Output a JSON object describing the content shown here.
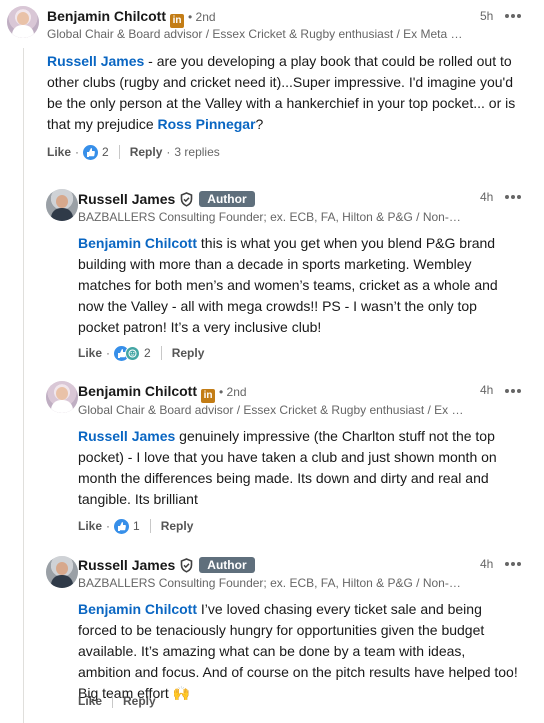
{
  "comments": [
    {
      "author": "Benjamin Chilcott",
      "linkedin_badge": "in",
      "degree": "• 2nd",
      "headline": "Global Chair & Board advisor / Essex Cricket & Rugby enthusiast / Ex Meta (u...",
      "time": "5h",
      "body": {
        "mention1": "Russell James",
        "text1": " - are you developing a play book that could be rolled out to other clubs (rugby and cricket need it)...Super impressive. I'd imagine you'd be the only person at the Valley with a hankerchief in your top pocket... or is that my prejudice ",
        "mention2": "Ross Pinnegar",
        "text2": "?"
      },
      "like_label": "Like",
      "reaction_count": "2",
      "reply_label": "Reply",
      "replies_count": "3 replies"
    },
    {
      "author": "Russell James",
      "author_badge": "Author",
      "headline": "BAZBALLERS Consulting Founder; ex. ECB, FA, Hilton & P&G / Non-Exe...",
      "time": "4h",
      "body": {
        "mention1": "Benjamin Chilcott",
        "text1": " this is what you get when you blend P&G brand building with more than a decade in sports marketing. Wembley matches for both men’s and women’s teams, cricket as a whole and now the Valley - all with mega crowds!! PS - I wasn’t the only top pocket patron! It’s a very inclusive club!"
      },
      "like_label": "Like",
      "reaction_count": "2",
      "reply_label": "Reply"
    },
    {
      "author": "Benjamin Chilcott",
      "linkedin_badge": "in",
      "degree": "• 2nd",
      "headline": "Global Chair & Board advisor / Essex Cricket & Rugby enthusiast / Ex M...",
      "time": "4h",
      "body": {
        "mention1": "Russell James",
        "text1": " genuinely impressive (the Charlton stuff not the top pocket) - I love that you have taken a club and just shown month on month the differences being made. Its down and dirty and real and tangible. Its brilliant"
      },
      "like_label": "Like",
      "reaction_count": "1",
      "reply_label": "Reply"
    },
    {
      "author": "Russell James",
      "author_badge": "Author",
      "headline": "BAZBALLERS Consulting Founder; ex. ECB, FA, Hilton & P&G / Non-Exe...",
      "time": "4h",
      "body": {
        "mention1": "Benjamin Chilcott",
        "text1": " I’ve loved chasing every ticket sale and being forced to be tenaciously hungry for opportunities given the budget available. It’s amazing what can be done by a team with ideas, ambition and focus. And of course on the pitch results have helped too! Big team effort 🙌"
      },
      "like_label": "Like",
      "reply_label": "Reply"
    }
  ],
  "colors": {
    "link": "#0a66c2",
    "author_badge": "#5f6f7c",
    "like_reaction": "#378fe9"
  },
  "icons": [
    "more-icon",
    "shield-icon",
    "like-reaction-icon",
    "celebrate-reaction-icon",
    "linkedin-badge-icon"
  ]
}
